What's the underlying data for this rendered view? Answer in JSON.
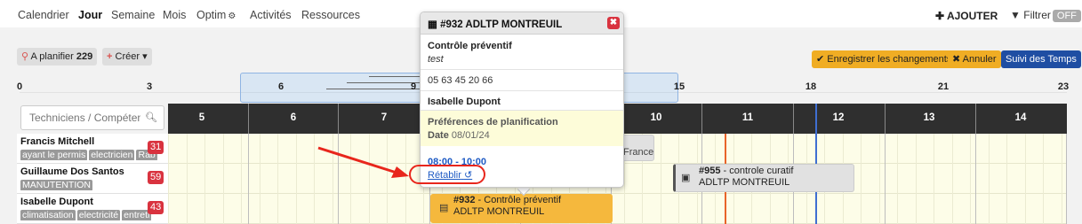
{
  "nav": {
    "items": [
      "Calendrier",
      "Jour",
      "Semaine",
      "Mois",
      "Optim",
      "Activités",
      "Ressources"
    ],
    "active": "Jour",
    "add_label": "AJOUTER",
    "filter_label": "Filtrer",
    "filter_state": "OFF"
  },
  "toolbar": {
    "plan_label": "A planifier",
    "plan_count": "229",
    "create_label": "Créer",
    "save_label": "Enregistrer les changements",
    "cancel_label": "Annuler",
    "suivi_label": "Suivi des Temps"
  },
  "ruler": {
    "labels": [
      "0",
      "3",
      "6",
      "9",
      "15",
      "18",
      "21",
      "23"
    ]
  },
  "search": {
    "placeholder": "Techniciens / Compétences"
  },
  "timeline": {
    "hours": [
      "5",
      "6",
      "7",
      "10",
      "11",
      "12",
      "13",
      "14"
    ]
  },
  "resources": [
    {
      "name": "Francis Mitchell",
      "tags": [
        "ayant le permis",
        "electricien",
        "Rab"
      ],
      "count": "31"
    },
    {
      "name": "Guillaume Dos Santos",
      "tags": [
        "MANUTENTION"
      ],
      "count": "59"
    },
    {
      "name": "Isabelle Dupont",
      "tags": [
        "climatisation",
        "electricité",
        "entreti"
      ],
      "count": "43"
    }
  ],
  "events": {
    "france_text": "France",
    "e955_id": "#955",
    "e955_type": " - controle curatif",
    "e955_client": "ADLTP MONTREUIL",
    "e932_id": "#932",
    "e932_type": " - Contrôle préventif",
    "e932_client": "ADLTP MONTREUIL"
  },
  "popup": {
    "title": "#932 ADLTP MONTREUIL",
    "type": "Contrôle préventif",
    "note": "test",
    "phone": "05 63 45 20 66",
    "technician": "Isabelle Dupont",
    "pref_title": "Préférences de planification",
    "date_label": "Date",
    "date_value": "08/01/24",
    "time": "08:00 - 10:00",
    "restore_label": "Rétablir"
  },
  "colors": {
    "accent_orange": "#f0ad24",
    "accent_blue": "#1f4ea3",
    "badge_red": "#d9333f",
    "annotation_red": "#e8261c"
  }
}
